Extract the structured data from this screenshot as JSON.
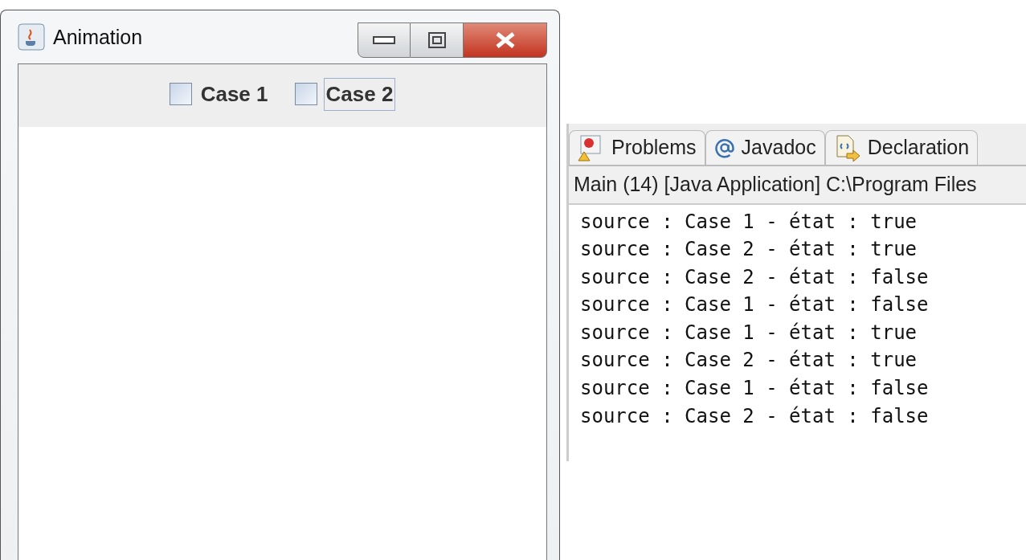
{
  "window": {
    "title": "Animation"
  },
  "checkboxes": [
    {
      "label": "Case 1",
      "checked": false,
      "focused": false
    },
    {
      "label": "Case 2",
      "checked": false,
      "focused": true
    }
  ],
  "console": {
    "tabs": [
      {
        "label": "Problems",
        "selected": false
      },
      {
        "label": "Javadoc",
        "selected": false
      },
      {
        "label": "Declaration",
        "selected": false
      }
    ],
    "header": "Main (14) [Java Application] C:\\Program Files",
    "lines": [
      "source : Case 1 - état : true",
      "source : Case 2 - état : true",
      "source : Case 2 - état : false",
      "source : Case 1 - état : false",
      "source : Case 1 - état : true",
      "source : Case 2 - état : true",
      "source : Case 1 - état : false",
      "source : Case 2 - état : false"
    ]
  }
}
